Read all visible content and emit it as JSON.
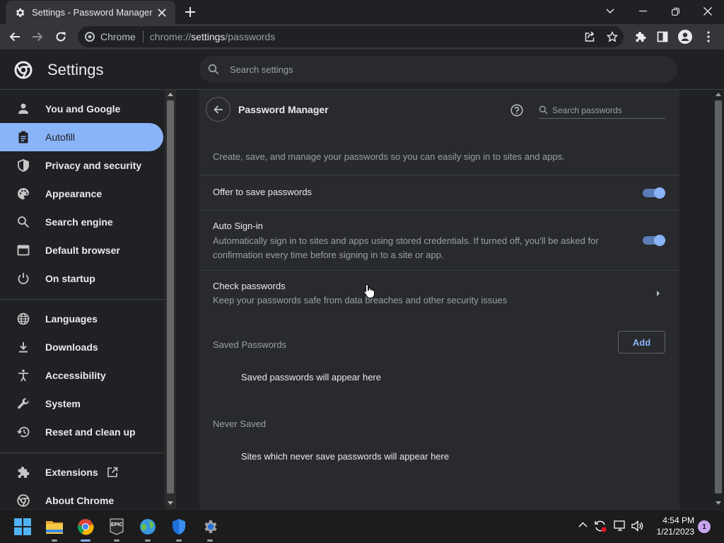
{
  "tab": {
    "title": "Settings - Password Manager"
  },
  "omnibox": {
    "chip": "Chrome",
    "url_prefix": "chrome://",
    "url_host": "settings",
    "url_path": "/passwords"
  },
  "header": {
    "title": "Settings",
    "search_placeholder": "Search settings"
  },
  "sidebar": {
    "items": [
      {
        "label": "You and Google",
        "icon": "person-icon"
      },
      {
        "label": "Autofill",
        "icon": "clipboard-icon",
        "active": true
      },
      {
        "label": "Privacy and security",
        "icon": "shield-icon"
      },
      {
        "label": "Appearance",
        "icon": "palette-icon"
      },
      {
        "label": "Search engine",
        "icon": "search-icon"
      },
      {
        "label": "Default browser",
        "icon": "browser-icon"
      },
      {
        "label": "On startup",
        "icon": "power-icon"
      },
      {
        "label": "Languages",
        "icon": "globe-icon"
      },
      {
        "label": "Downloads",
        "icon": "download-icon"
      },
      {
        "label": "Accessibility",
        "icon": "accessibility-icon"
      },
      {
        "label": "System",
        "icon": "wrench-icon"
      },
      {
        "label": "Reset and clean up",
        "icon": "restore-icon"
      },
      {
        "label": "Extensions",
        "icon": "puzzle-icon"
      },
      {
        "label": "About Chrome",
        "icon": "chrome-icon"
      }
    ]
  },
  "page": {
    "title": "Password Manager",
    "search_placeholder": "Search passwords",
    "description": "Create, save, and manage your passwords so you can easily sign in to sites and apps.",
    "offer_to_save": {
      "label": "Offer to save passwords",
      "enabled": true
    },
    "auto_signin": {
      "label": "Auto Sign-in",
      "description": "Automatically sign in to sites and apps using stored credentials. If turned off, you'll be asked for confirmation every time before signing in to a site or app.",
      "enabled": true
    },
    "check_passwords": {
      "label": "Check passwords",
      "description": "Keep your passwords safe from data breaches and other security issues"
    },
    "saved_passwords": {
      "heading": "Saved Passwords",
      "add_label": "Add",
      "empty_text": "Saved passwords will appear here"
    },
    "never_saved": {
      "heading": "Never Saved",
      "empty_text": "Sites which never save passwords will appear here"
    }
  },
  "taskbar": {
    "apps": [
      "windows-start-icon",
      "file-explorer-icon",
      "chrome-icon",
      "epic-games-icon",
      "maps-icon",
      "defender-icon",
      "settings-gear-icon"
    ],
    "epic_label": "EPIC",
    "time": "4:54 PM",
    "date": "1/21/2023",
    "notification_count": "1"
  },
  "colors": {
    "accent": "#8ab4f8",
    "background": "#202124",
    "card": "#292a2d"
  }
}
